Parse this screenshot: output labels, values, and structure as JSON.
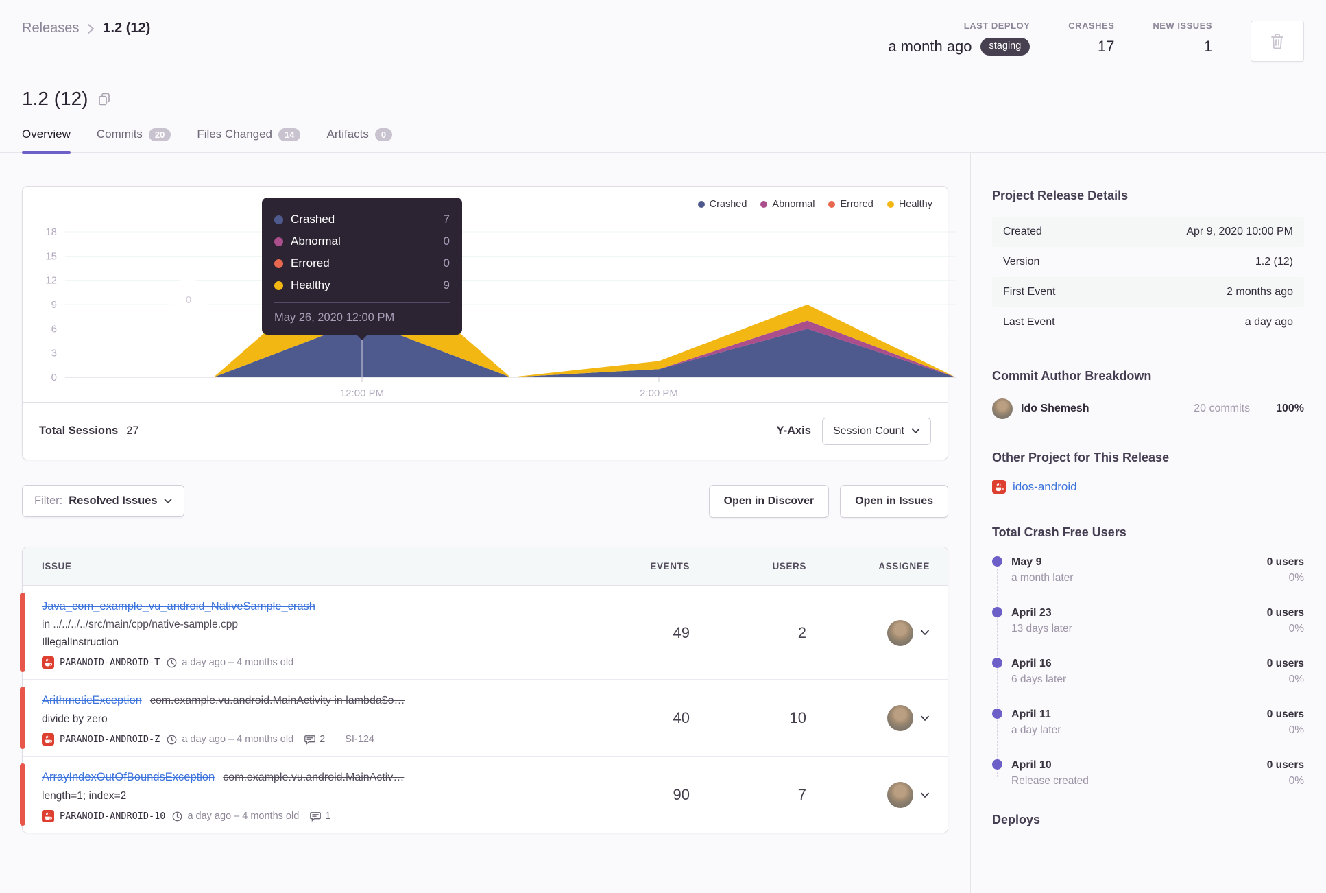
{
  "colors": {
    "accent": "#6c5fc7",
    "link": "#3d74db",
    "unhandled_red": "#e8564a",
    "project_icon_red": "#dd4030",
    "badge_bg": "#464050"
  },
  "breadcrumb": {
    "root": "Releases",
    "current": "1.2 (12)"
  },
  "header": {
    "last_deploy": {
      "label": "LAST DEPLOY",
      "value": "a month ago",
      "badge": "staging"
    },
    "crashes": {
      "label": "CRASHES",
      "value": "17"
    },
    "new_issues": {
      "label": "NEW ISSUES",
      "value": "1"
    }
  },
  "release": {
    "title": "1.2 (12)"
  },
  "tabs": [
    {
      "label": "Overview"
    },
    {
      "label": "Commits",
      "count": "20"
    },
    {
      "label": "Files Changed",
      "count": "14"
    },
    {
      "label": "Artifacts",
      "count": "0"
    }
  ],
  "chart_data": {
    "type": "area",
    "stacked": true,
    "x": [
      "10:00 AM",
      "11:00 AM",
      "12:00 PM",
      "1:00 PM",
      "2:00 PM",
      "3:00 PM",
      "4:00 PM"
    ],
    "x_tick_labels": [
      {
        "index": 2,
        "label": "12:00 PM"
      },
      {
        "index": 4,
        "label": "2:00 PM"
      }
    ],
    "yticks": [
      0,
      3,
      6,
      9,
      12,
      15,
      18
    ],
    "ylim": [
      0,
      18
    ],
    "series": [
      {
        "name": "Crashed",
        "color": "#4e5a8e",
        "values": [
          0,
          0,
          7,
          0,
          1,
          6,
          0
        ]
      },
      {
        "name": "Abnormal",
        "color": "#aa4e8c",
        "values": [
          0,
          0,
          0,
          0,
          0,
          1,
          0
        ]
      },
      {
        "name": "Errored",
        "color": "#e8674f",
        "values": [
          0,
          0,
          0,
          0,
          0,
          0,
          0
        ]
      },
      {
        "name": "Healthy",
        "color": "#f2b712",
        "values": [
          0,
          0,
          9,
          0,
          1,
          2,
          0
        ]
      }
    ],
    "legend_position": "top-right",
    "pointer_index": 2,
    "watermark": "0",
    "total_sessions": 27
  },
  "chart_tooltip": {
    "rows": [
      {
        "name": "Crashed",
        "value": "7"
      },
      {
        "name": "Abnormal",
        "value": "0"
      },
      {
        "name": "Errored",
        "value": "0"
      },
      {
        "name": "Healthy",
        "value": "9"
      }
    ],
    "footer": "May 26, 2020 12:00 PM"
  },
  "chart_footer": {
    "total_label": "Total Sessions",
    "total_value": "27",
    "yaxis_label": "Y-Axis",
    "yaxis_value": "Session Count"
  },
  "toolbar": {
    "filter_label": "Filter:",
    "filter_value": "Resolved Issues",
    "discover_label": "Open in Discover",
    "issues_label": "Open in Issues"
  },
  "issues": {
    "columns": {
      "issue": "ISSUE",
      "events": "EVENTS",
      "users": "USERS",
      "assignee": "ASSIGNEE"
    },
    "rows": [
      {
        "title": "Java_com_example_vu_android_NativeSample_crash",
        "culprit": "",
        "location": "in ../../../../src/main/cpp/native-sample.cpp",
        "detail": "IllegalInstruction",
        "project": "PARANOID-ANDROID-T",
        "age": "a day ago – 4 months old",
        "comments": "",
        "ref": "",
        "events": "49",
        "users": "2"
      },
      {
        "title": "ArithmeticException",
        "culprit": "com.example.vu.android.MainActivity in lambda$o…",
        "location": "",
        "detail": "divide by zero",
        "project": "PARANOID-ANDROID-Z",
        "age": "a day ago – 4 months old",
        "comments": "2",
        "ref": "SI-124",
        "events": "40",
        "users": "10"
      },
      {
        "title": "ArrayIndexOutOfBoundsException",
        "culprit": "com.example.vu.android.MainActiv…",
        "location": "",
        "detail": "length=1; index=2",
        "project": "PARANOID-ANDROID-10",
        "age": "a day ago – 4 months old",
        "comments": "1",
        "ref": "",
        "events": "90",
        "users": "7"
      }
    ]
  },
  "sidebar": {
    "details": {
      "title": "Project Release Details",
      "rows": [
        {
          "key": "Created",
          "value": "Apr 9, 2020 10:00 PM"
        },
        {
          "key": "Version",
          "value": "1.2 (12)"
        },
        {
          "key": "First Event",
          "value": "2 months ago"
        },
        {
          "key": "Last Event",
          "value": "a day ago"
        }
      ]
    },
    "authors": {
      "title": "Commit Author Breakdown",
      "name": "Ido Shemesh",
      "commits": "20 commits",
      "percent": "100%"
    },
    "other_project": {
      "title": "Other Project for This Release",
      "link": "idos-android"
    },
    "crash_free": {
      "title": "Total Crash Free Users",
      "entries": [
        {
          "date": "May 9",
          "sub": "a month later",
          "users": "0 users",
          "pct": "0%"
        },
        {
          "date": "April 23",
          "sub": "13 days later",
          "users": "0 users",
          "pct": "0%"
        },
        {
          "date": "April 16",
          "sub": "6 days later",
          "users": "0 users",
          "pct": "0%"
        },
        {
          "date": "April 11",
          "sub": "a day later",
          "users": "0 users",
          "pct": "0%"
        },
        {
          "date": "April 10",
          "sub": "Release created",
          "users": "0 users",
          "pct": "0%"
        }
      ]
    },
    "deploys": {
      "title": "Deploys"
    }
  }
}
